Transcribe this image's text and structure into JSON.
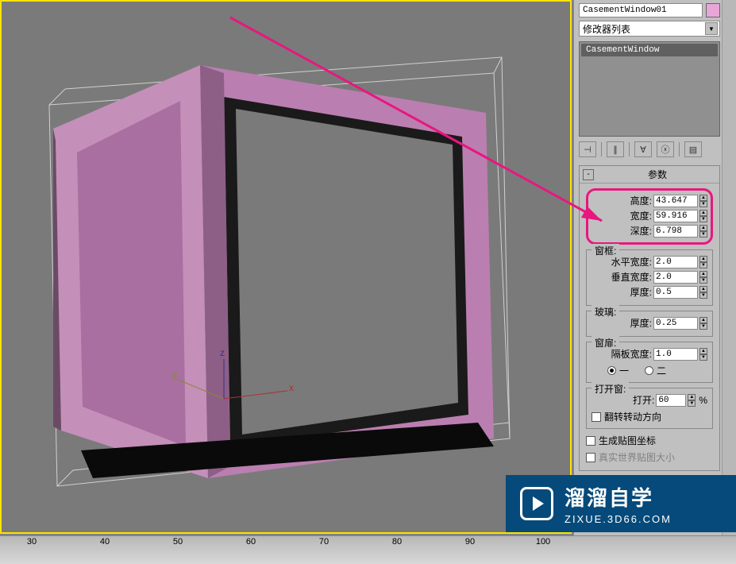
{
  "object_name": "CasementWindow01",
  "modifier_dropdown": "修改器列表",
  "modifier_stack": {
    "item": "CasementWindow"
  },
  "rollout": {
    "title": "参数",
    "dims": {
      "height_label": "高度:",
      "height_value": "43.647",
      "width_label": "宽度:",
      "width_value": "59.916",
      "depth_label": "深度:",
      "depth_value": "6.798"
    },
    "frame": {
      "legend": "窗框:",
      "hw_label": "水平宽度:",
      "hw_value": "2.0",
      "vw_label": "垂直宽度:",
      "vw_value": "2.0",
      "th_label": "厚度:",
      "th_value": "0.5"
    },
    "glass": {
      "legend": "玻璃:",
      "th_label": "厚度:",
      "th_value": "0.25"
    },
    "casement": {
      "legend": "窗扉:",
      "pw_label": "隔板宽度:",
      "pw_value": "1.0",
      "opt_one": "一",
      "opt_two": "二"
    },
    "open": {
      "legend": "打开窗:",
      "label": "打开:",
      "value": "60",
      "unit": "%",
      "flip_label": "翻转转动方向"
    },
    "map": {
      "gen_label": "生成贴图坐标",
      "real_label": "真实世界贴图大小"
    }
  },
  "ruler": {
    "ticks": [
      "30",
      "40",
      "50",
      "60",
      "70",
      "80",
      "90",
      "100"
    ]
  },
  "watermark": {
    "title": "溜溜自学",
    "url": "ZIXUE.3D66.COM"
  }
}
